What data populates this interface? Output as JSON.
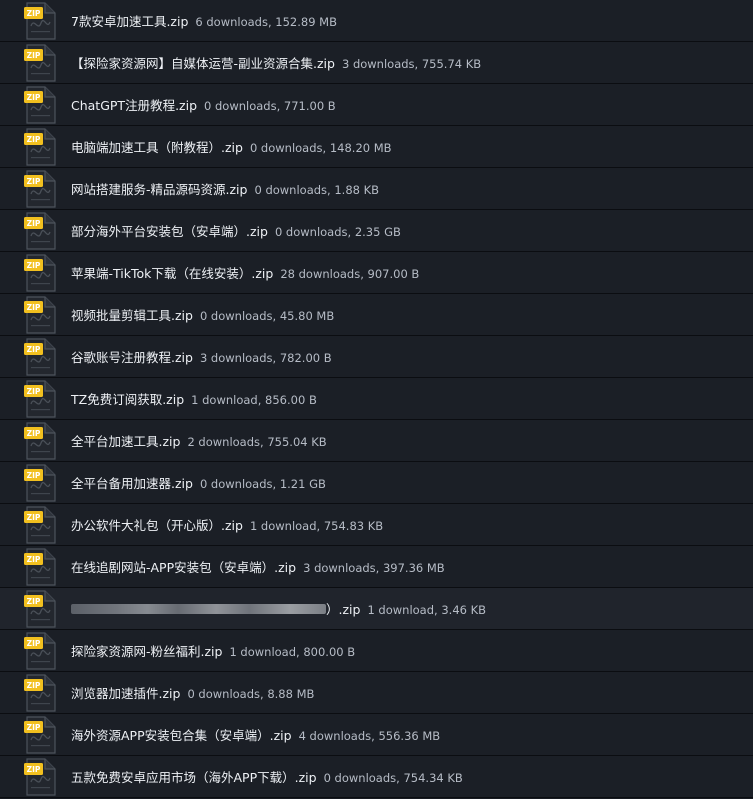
{
  "file_list": {
    "items": [
      {
        "name": "7款安卓加速工具.zip",
        "meta": "6 downloads, 152.89 MB",
        "icon": "zip-file-icon"
      },
      {
        "name": "【探险家资源网】自媒体运营-副业资源合集.zip",
        "meta": "3 downloads, 755.74 KB",
        "icon": "zip-file-icon"
      },
      {
        "name": "ChatGPT注册教程.zip",
        "meta": "0 downloads, 771.00 B",
        "icon": "zip-file-icon"
      },
      {
        "name": "电脑端加速工具（附教程）.zip",
        "meta": "0 downloads, 148.20 MB",
        "icon": "zip-file-icon"
      },
      {
        "name": "网站搭建服务-精品源码资源.zip",
        "meta": "0 downloads, 1.88 KB",
        "icon": "zip-file-icon"
      },
      {
        "name": "部分海外平台安装包（安卓端）.zip",
        "meta": "0 downloads, 2.35 GB",
        "icon": "zip-file-icon"
      },
      {
        "name": "苹果端-TikTok下载（在线安装）.zip",
        "meta": "28 downloads, 907.00 B",
        "icon": "zip-file-icon"
      },
      {
        "name": "视频批量剪辑工具.zip",
        "meta": "0 downloads, 45.80 MB",
        "icon": "zip-file-icon"
      },
      {
        "name": "谷歌账号注册教程.zip",
        "meta": "3 downloads, 782.00 B",
        "icon": "zip-file-icon"
      },
      {
        "name": "TZ免费订阅获取.zip",
        "meta": "1 download, 856.00 B",
        "icon": "zip-file-icon"
      },
      {
        "name": "全平台加速工具.zip",
        "meta": "2 downloads, 755.04 KB",
        "icon": "zip-file-icon"
      },
      {
        "name": "全平台备用加速器.zip",
        "meta": "0 downloads, 1.21 GB",
        "icon": "zip-file-icon"
      },
      {
        "name": "办公软件大礼包（开心版）.zip",
        "meta": "1 download, 754.83 KB",
        "icon": "zip-file-icon"
      },
      {
        "name": "在线追剧网站-APP安装包（安卓端）.zip",
        "meta": "3 downloads, 397.36 MB",
        "icon": "zip-file-icon"
      },
      {
        "name": "）.zip",
        "meta": "1 download, 3.46 KB",
        "icon": "zip-file-icon",
        "redacted": true
      },
      {
        "name": "探险家资源网-粉丝福利.zip",
        "meta": "1 download, 800.00 B",
        "icon": "zip-file-icon"
      },
      {
        "name": "浏览器加速插件.zip",
        "meta": "0 downloads, 8.88 MB",
        "icon": "zip-file-icon"
      },
      {
        "name": "海外资源APP安装包合集（安卓端）.zip",
        "meta": "4 downloads, 556.36 MB",
        "icon": "zip-file-icon"
      },
      {
        "name": "五款免费安卓应用市场（海外APP下载）.zip",
        "meta": "0 downloads, 754.34 KB",
        "icon": "zip-file-icon"
      }
    ]
  },
  "colors": {
    "background": "#171b22",
    "row": "#1b1f26",
    "row_hover": "#20242c",
    "name_text": "#eef1f5",
    "meta_text": "#b6bcc6",
    "zip_tag": "#f2c01f"
  }
}
